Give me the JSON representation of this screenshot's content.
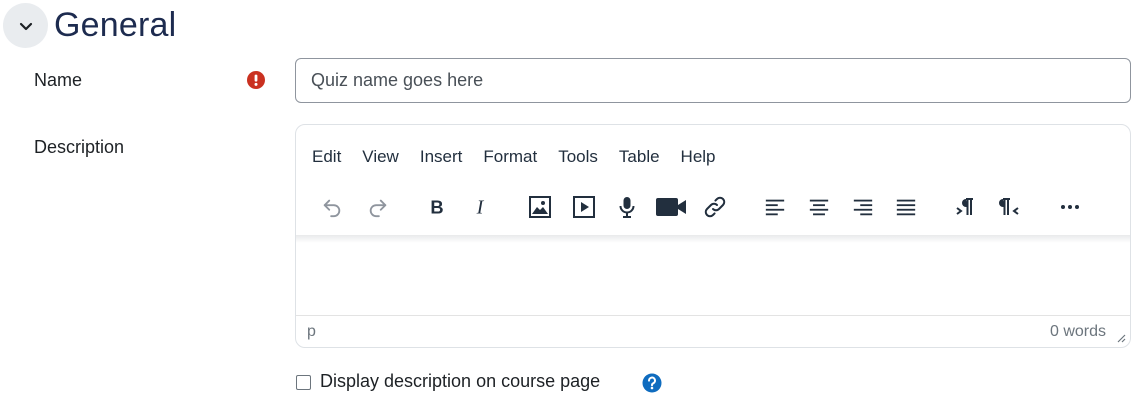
{
  "section": {
    "title": "General",
    "collapse_icon": "chevron-down-icon"
  },
  "name_field": {
    "label": "Name",
    "required_icon": "exclamation-circle-icon",
    "placeholder": "Quiz name goes here",
    "value": ""
  },
  "description_field": {
    "label": "Description",
    "editor": {
      "menu": [
        "Edit",
        "View",
        "Insert",
        "Format",
        "Tools",
        "Table",
        "Help"
      ],
      "toolbar": [
        "undo-icon",
        "redo-icon",
        "bold-icon",
        "italic-icon",
        "image-icon",
        "media-icon",
        "microphone-icon",
        "video-camera-icon",
        "link-icon",
        "align-left-icon",
        "align-center-icon",
        "align-right-icon",
        "justify-icon",
        "ltr-icon",
        "rtl-icon",
        "more-icon"
      ],
      "content": "",
      "status_path": "p",
      "word_count": "0 words"
    }
  },
  "display_description": {
    "label": "Display description on course page",
    "checked": false,
    "help_icon": "question-circle-icon"
  },
  "colors": {
    "title": "#1d2b4f",
    "required": "#ca3120",
    "help": "#0f6cbf",
    "toolbar_icon": "#222f3e",
    "toolbar_disabled": "#8f959e"
  }
}
